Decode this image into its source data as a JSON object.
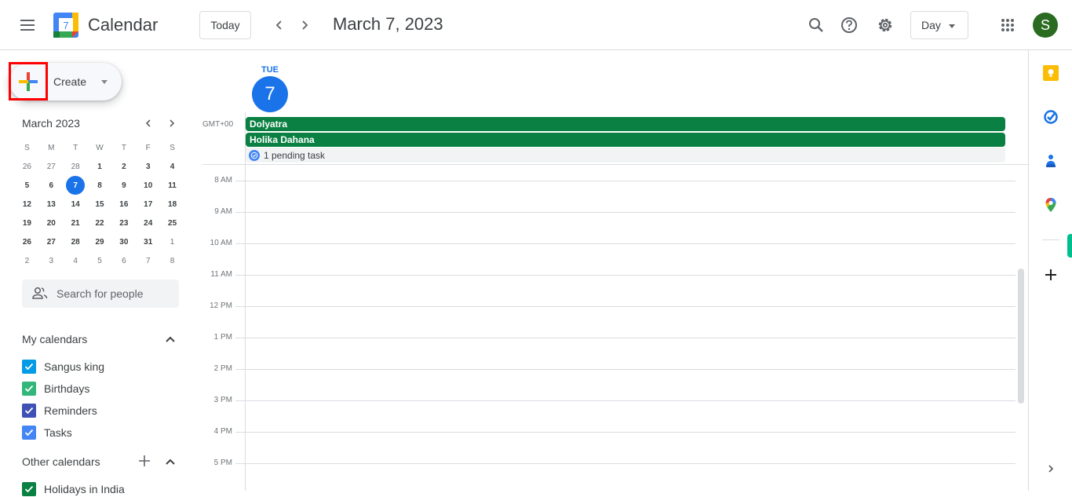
{
  "header": {
    "app_title": "Calendar",
    "logo_day": "7",
    "today_label": "Today",
    "date_title": "March 7, 2023",
    "view_select": "Day",
    "avatar_initial": "S",
    "icons": [
      "menu-icon",
      "prev-icon",
      "next-icon",
      "search-icon",
      "help-icon",
      "settings-icon",
      "apps-grid-icon"
    ]
  },
  "create": {
    "label": "Create"
  },
  "mini_calendar": {
    "title": "March 2023",
    "weekdays": [
      "S",
      "M",
      "T",
      "W",
      "T",
      "F",
      "S"
    ],
    "weeks": [
      [
        "26",
        "27",
        "28",
        "1",
        "2",
        "3",
        "4"
      ],
      [
        "5",
        "6",
        "7",
        "8",
        "9",
        "10",
        "11"
      ],
      [
        "12",
        "13",
        "14",
        "15",
        "16",
        "17",
        "18"
      ],
      [
        "19",
        "20",
        "21",
        "22",
        "23",
        "24",
        "25"
      ],
      [
        "26",
        "27",
        "28",
        "29",
        "30",
        "31",
        "1"
      ],
      [
        "2",
        "3",
        "4",
        "5",
        "6",
        "7",
        "8"
      ]
    ],
    "selected": "7"
  },
  "people_search": {
    "placeholder": "Search for people"
  },
  "my_calendars": {
    "title": "My calendars",
    "items": [
      {
        "label": "Sangus king",
        "color": "#039be5",
        "checked": true
      },
      {
        "label": "Birthdays",
        "color": "#33b679",
        "checked": true
      },
      {
        "label": "Reminders",
        "color": "#3f51b5",
        "checked": true
      },
      {
        "label": "Tasks",
        "color": "#4285f4",
        "checked": true
      }
    ]
  },
  "other_calendars": {
    "title": "Other calendars",
    "items": [
      {
        "label": "Holidays in India",
        "color": "#0b8043",
        "checked": true
      }
    ]
  },
  "day_view": {
    "dow": "TUE",
    "day_number": "7",
    "timezone": "GMT+00",
    "all_day_events": [
      {
        "title": "Dolyatra",
        "color": "#0b8043"
      },
      {
        "title": "Holika Dahana",
        "color": "#0b8043"
      }
    ],
    "pending_tasks": "1 pending task",
    "hours": [
      "8 AM",
      "9 AM",
      "10 AM",
      "11 AM",
      "12 PM",
      "1 PM",
      "2 PM",
      "3 PM",
      "4 PM",
      "5 PM"
    ]
  },
  "side_panel": {
    "icons": [
      "keep-icon",
      "tasks-icon",
      "contacts-icon",
      "maps-icon",
      "add-addon-icon",
      "expand-panel-icon"
    ]
  }
}
